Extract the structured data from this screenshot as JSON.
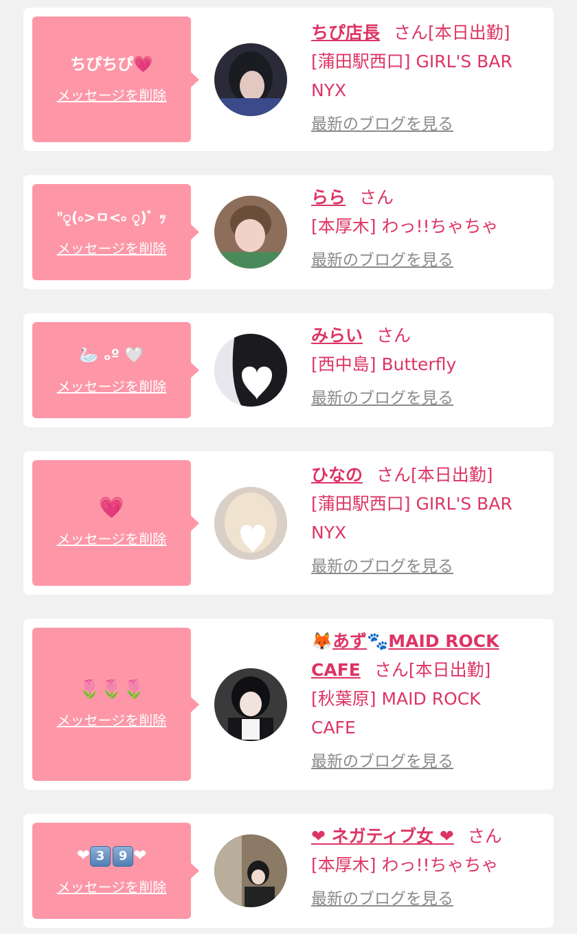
{
  "delete_label": "メッセージを削除",
  "blog_label": "最新のブログを見る",
  "san_label": "さん",
  "cards": [
    {
      "message": "ちぴちぴ",
      "message_emoji": "💗",
      "name": "ちぴ店長",
      "status": "[本日出勤]",
      "location": "[蒲田駅西口] GIRL'S BAR",
      "location_cont": "NYX"
    },
    {
      "message": "\"ृ(৹>ㅁ<৹ ृ)ﾞ ｯ",
      "name": "らら",
      "location": "[本厚木] わっ!!ちゃちゃ"
    },
    {
      "message": "🦢 ₒº 🤍",
      "name": "みらい",
      "location": "[西中島] Butterfly"
    },
    {
      "message": "💗",
      "name": "ひなの",
      "status": "[本日出勤]",
      "location": "[蒲田駅西口] GIRL'S BAR",
      "location_cont": "NYX"
    },
    {
      "message": "🌷🌷🌷",
      "name_emoji_1": "🦊",
      "name_part_1": "あず",
      "name_emoji_2": "🐾",
      "name_part_2": "MAID ROCK",
      "name_part_3": "CAFE",
      "status": "[本日出勤]",
      "location": "[秋葉原] MAID ROCK",
      "location_cont": "CAFE"
    },
    {
      "message_left": "❤",
      "message_key_1": "3",
      "message_key_2": "9",
      "message_right": "❤",
      "name": "❤ ネガティブ女 ❤",
      "location": "[本厚木] わっ!!ちゃちゃ"
    }
  ]
}
